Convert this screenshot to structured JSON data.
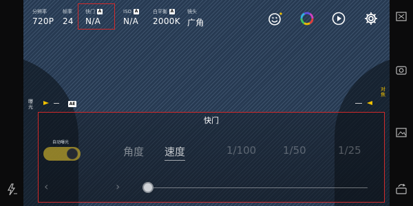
{
  "top_params": [
    {
      "label": "分辨率",
      "value": "720P",
      "auto": false
    },
    {
      "label": "帧率",
      "value": "24",
      "auto": false
    },
    {
      "label": "快门",
      "value": "N/A",
      "auto": true
    },
    {
      "label": "ISO",
      "value": "N/A",
      "auto": true
    },
    {
      "label": "白平衡",
      "value": "2000K",
      "auto": true
    },
    {
      "label": "镜头",
      "value": "广角",
      "auto": false
    }
  ],
  "auto_badge": "A",
  "left_overlay": {
    "label": "曝光",
    "badge": "AE"
  },
  "right_overlay": {
    "label": "对焦"
  },
  "panel": {
    "title": "快门",
    "auto_exposure_label": "自动曝光",
    "options": [
      "角度",
      "速度"
    ],
    "values": [
      "1/100",
      "1/50",
      "1/25"
    ],
    "prev_arrow": "‹",
    "next_arrow": "›"
  },
  "accent_colors": {
    "highlight_box": "#d32a2a",
    "toggle": "#b9a12b",
    "marker": "#f0c000"
  },
  "icons": [
    "smile-icon",
    "color-wheel-icon",
    "play-icon",
    "gear-icon",
    "flash-off-icon",
    "rotate-icon",
    "aspect-icon",
    "camera-icon",
    "photo-icon"
  ]
}
